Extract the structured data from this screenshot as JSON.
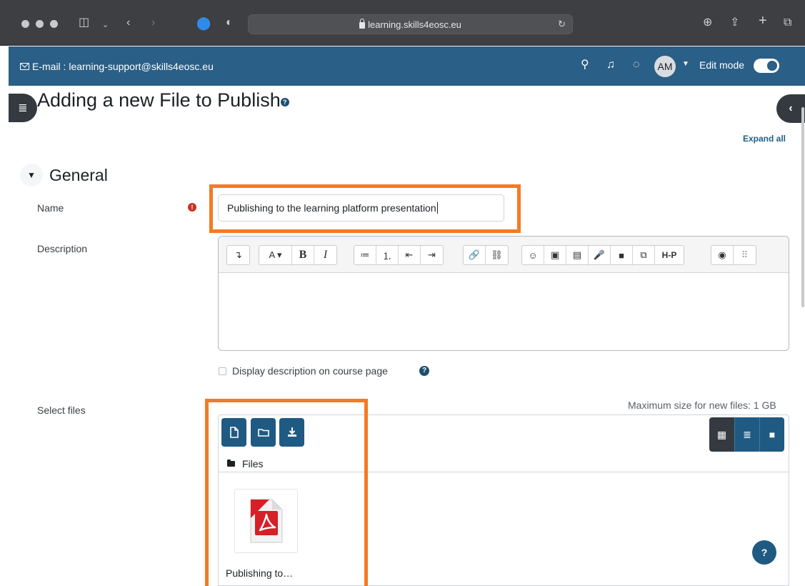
{
  "browser": {
    "url": "learning.skills4eosc.eu"
  },
  "navbar": {
    "email": "E-mail : learning-support@skills4eosc.eu",
    "avatar_initials": "AM",
    "edit_mode_label": "Edit mode",
    "edit_mode_on": true
  },
  "page": {
    "title": "Adding a new File to Publish",
    "expand_all": "Expand all"
  },
  "section": {
    "title": "General"
  },
  "form": {
    "name_label": "Name",
    "name_value": "Publishing to the learning platform presentation",
    "description_label": "Description",
    "editor_toolbar": {
      "groups": [
        [
          "↴"
        ],
        [
          "A ▾",
          "B",
          "I"
        ],
        [
          "≔",
          "⒈",
          "⇤",
          "⇥"
        ],
        [
          "🔗",
          "⛓"
        ],
        [
          "☺",
          "▣",
          "▤",
          "🎤",
          "■",
          "⧉",
          "H-P"
        ],
        [
          "◉",
          "⠿"
        ]
      ]
    },
    "display_description_label": "Display description on course page",
    "display_description_checked": false,
    "select_files_label": "Select files",
    "max_size": "Maximum size for new files: 1 GB"
  },
  "filemanager": {
    "path_label": "Files",
    "files": [
      {
        "name": "Publishing to…",
        "type": "pdf"
      }
    ]
  },
  "colors": {
    "navbar": "#2a5f87",
    "primary": "#1f5a83",
    "highlight": "#f47a26",
    "required": "#ca3120"
  }
}
